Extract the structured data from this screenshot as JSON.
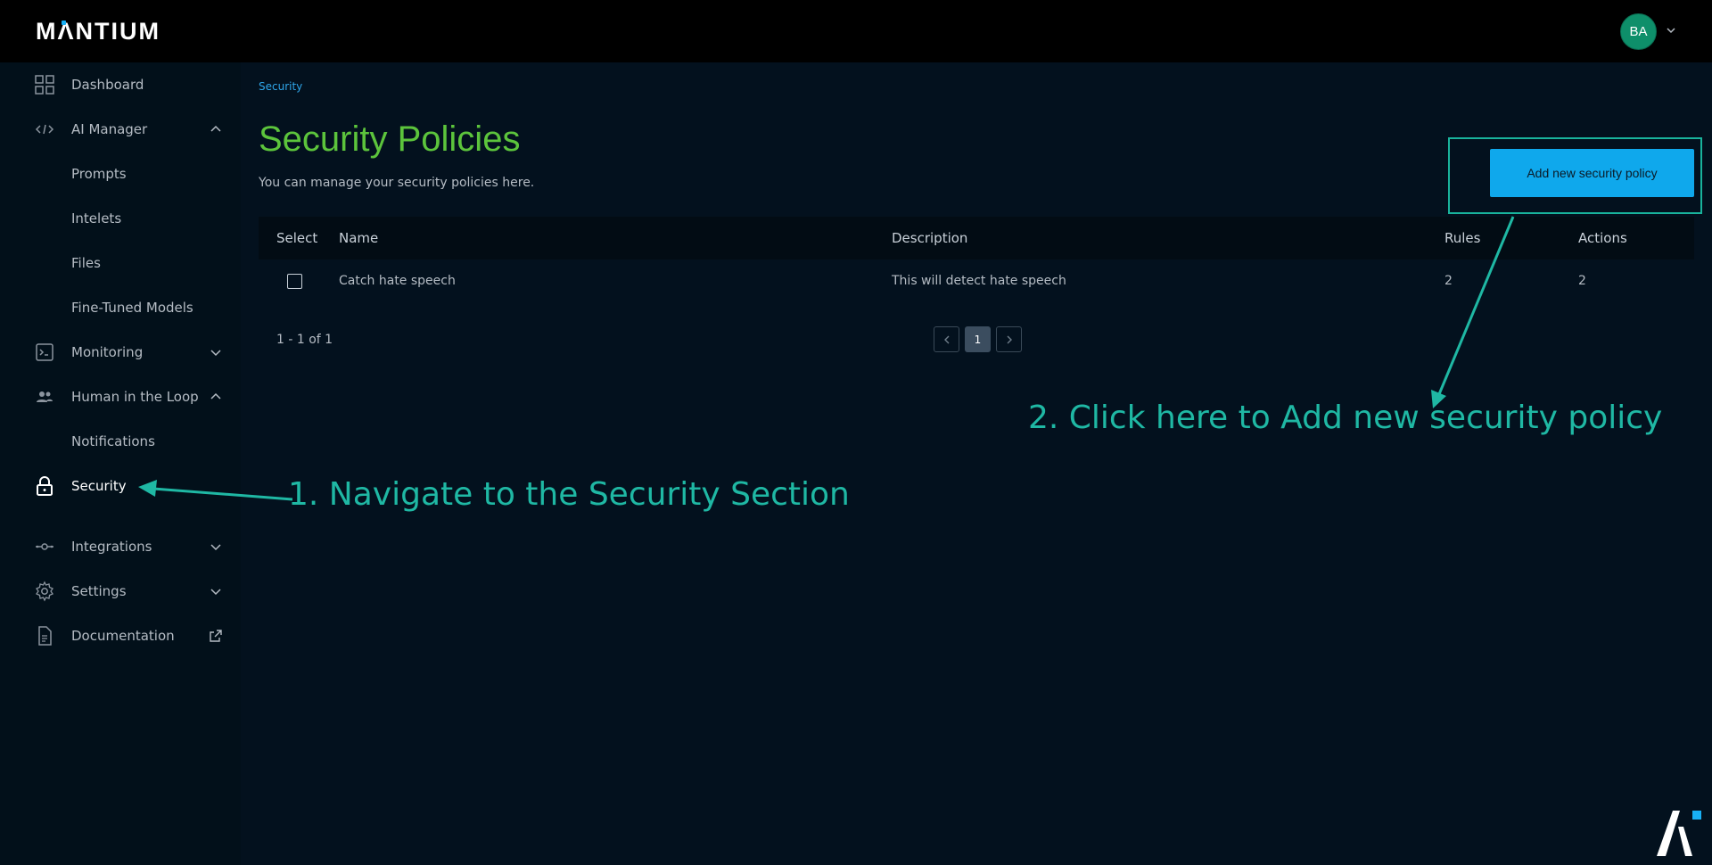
{
  "header": {
    "logo_text_pre": "M",
    "logo_text_a": "Λ",
    "logo_text_post": "NTIUM",
    "avatar_initials": "BA"
  },
  "sidebar": {
    "items": [
      {
        "label": "Dashboard",
        "icon": "grid-icon"
      },
      {
        "label": "AI Manager",
        "icon": "code-icon",
        "expanded": true
      },
      {
        "label": "Prompts"
      },
      {
        "label": "Intelets"
      },
      {
        "label": "Files"
      },
      {
        "label": "Fine-Tuned Models"
      },
      {
        "label": "Monitoring",
        "icon": "terminal-icon",
        "expanded": false
      },
      {
        "label": "Human in the Loop",
        "icon": "people-icon",
        "expanded": true
      },
      {
        "label": "Notifications"
      },
      {
        "label": "Security",
        "icon": "lock-icon",
        "active": true
      },
      {
        "label": "Integrations",
        "icon": "integration-icon",
        "expanded": false
      },
      {
        "label": "Settings",
        "icon": "gear-icon",
        "expanded": false
      },
      {
        "label": "Documentation",
        "icon": "document-icon",
        "external": true
      }
    ]
  },
  "main": {
    "breadcrumb": "Security",
    "title": "Security Policies",
    "subtitle": "You can manage your security policies here.",
    "add_button_label": "Add new security policy",
    "table": {
      "columns": [
        "Select",
        "Name",
        "Description",
        "Rules",
        "Actions"
      ],
      "rows": [
        {
          "name": "Catch hate speech",
          "description": "This will detect hate speech",
          "rules": "2",
          "actions": "2",
          "selected": false
        }
      ]
    },
    "pagination": {
      "summary": "1 - 1 of 1",
      "current_page": "1"
    }
  },
  "annotations": {
    "step1": "1. Navigate to the Security Section",
    "step2": "2. Click here to Add new security policy"
  },
  "colors": {
    "accent_green": "#5cc43c",
    "accent_blue": "#0fa8ec",
    "annotation_teal": "#1fb8a4",
    "background": "#03111e"
  }
}
